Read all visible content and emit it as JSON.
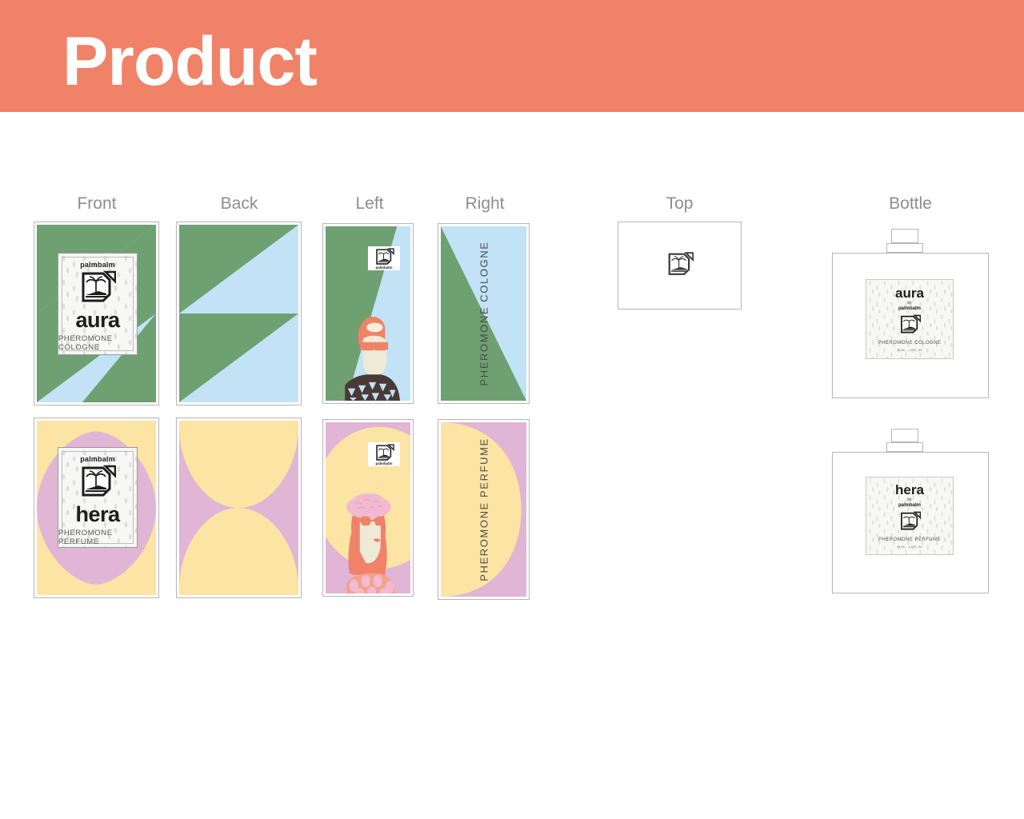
{
  "header": {
    "title": "Product",
    "bg_color": "#F08268",
    "text_color": "#FFFFFF"
  },
  "columns": [
    {
      "key": "front",
      "label": "Front"
    },
    {
      "key": "back",
      "label": "Back"
    },
    {
      "key": "left",
      "label": "Left"
    },
    {
      "key": "right",
      "label": "Right"
    },
    {
      "key": "top",
      "label": "Top"
    },
    {
      "key": "bottle",
      "label": "Bottle"
    }
  ],
  "palette": {
    "green": "#6FA072",
    "blue": "#C2E3F5",
    "pink": "#E0B5D6",
    "yellow": "#FBE4A4",
    "coral": "#F08268",
    "cream": "#EFEAD8",
    "dark": "#4A3A37",
    "hat_pink": "#F3B9D0",
    "label_bg": "#F7F7F5",
    "frame": "#B6B6B6"
  },
  "brand": {
    "name": "palmbalm",
    "logo_icon": "palm-tree-badge-icon",
    "by_word": "by"
  },
  "products": [
    {
      "id": "aura",
      "name": "aura",
      "descriptor": "PHEROMONE COLOGNE",
      "volume": "44 ML - 1.5 FL OZ",
      "brand": "palmbalm",
      "colors": {
        "primary": "#6FA072",
        "secondary": "#C2E3F5"
      },
      "side_text": "PHEROMONE COLOGNE"
    },
    {
      "id": "hera",
      "name": "hera",
      "descriptor": "PHEROMONE PERFUME",
      "volume": "44 ML - 1.5 FL OZ",
      "brand": "palmbalm",
      "colors": {
        "primary": "#E0B5D6",
        "secondary": "#FBE4A4"
      },
      "side_text": "PHEROMONE PERFUME"
    }
  ]
}
